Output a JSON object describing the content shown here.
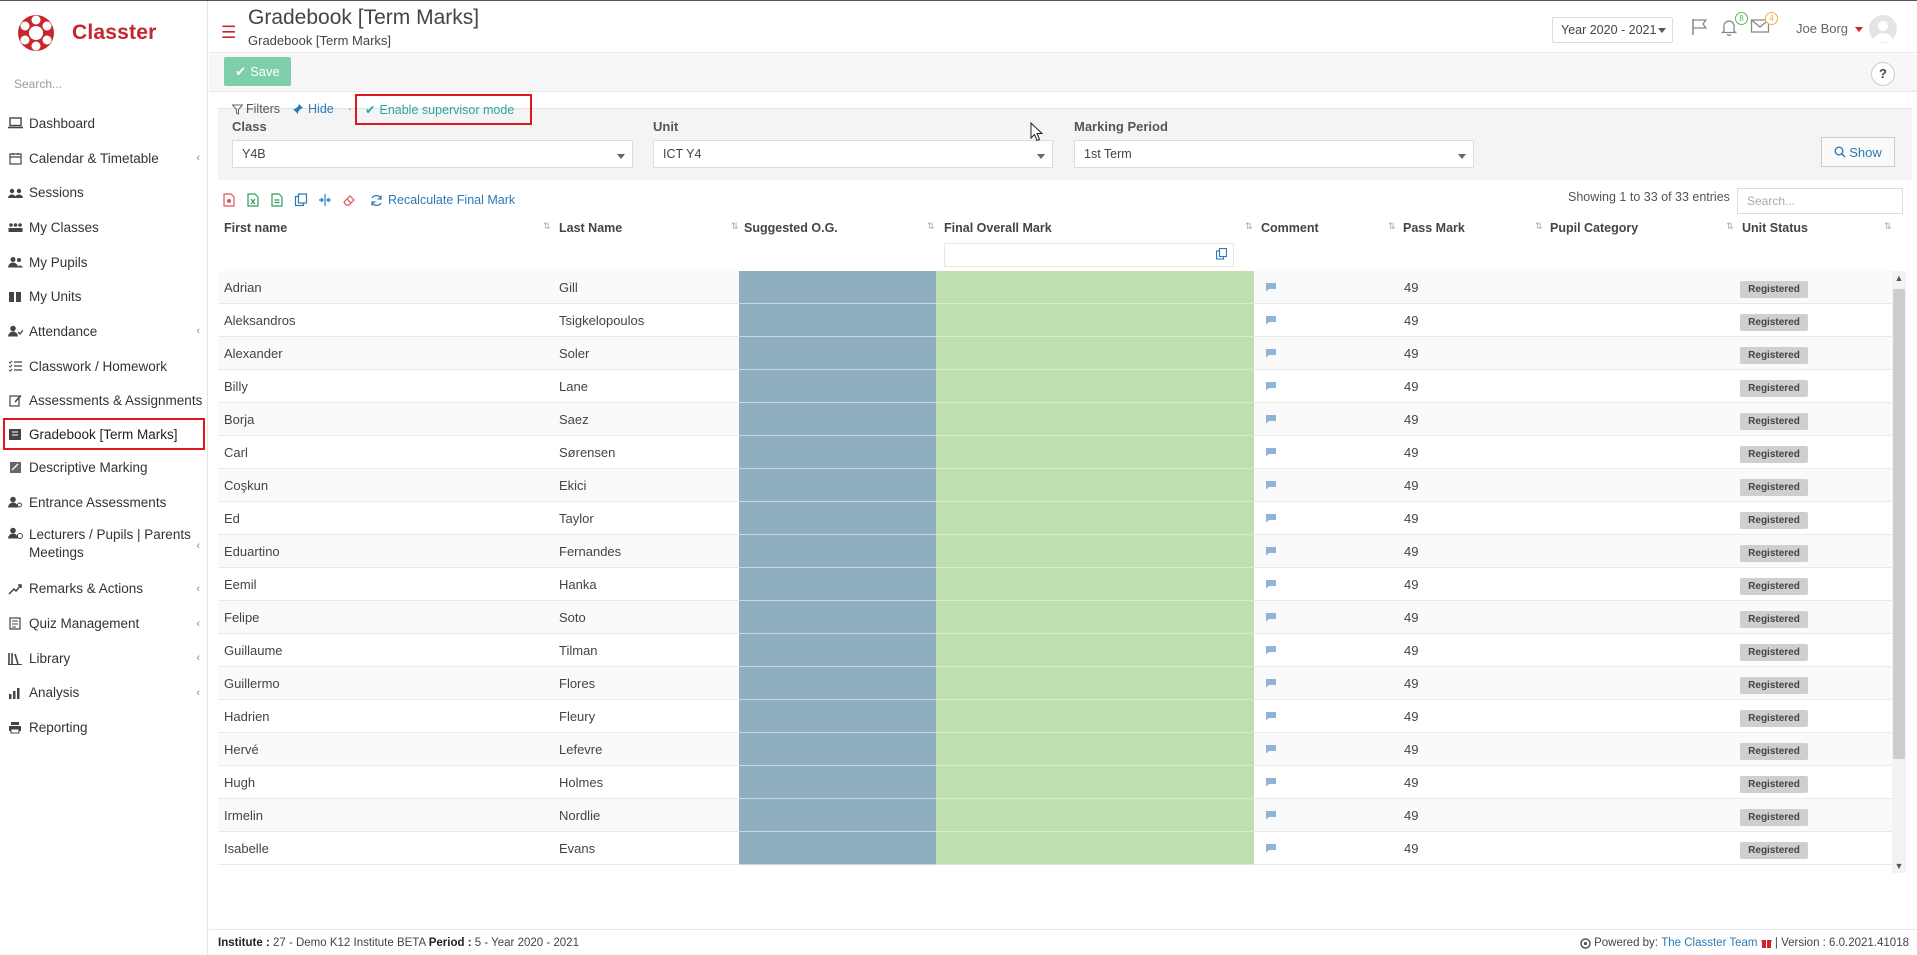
{
  "brand": {
    "name": "Classter"
  },
  "sidebar": {
    "search_placeholder": "Search...",
    "items": [
      {
        "label": "Dashboard",
        "icon": "laptop-icon",
        "chevron": false
      },
      {
        "label": "Calendar & Timetable",
        "icon": "calendar-icon",
        "chevron": true
      },
      {
        "label": "Sessions",
        "icon": "sessions-icon",
        "chevron": false
      },
      {
        "label": "My Classes",
        "icon": "classes-icon",
        "chevron": false
      },
      {
        "label": "My Pupils",
        "icon": "pupils-icon",
        "chevron": false
      },
      {
        "label": "My Units",
        "icon": "book-icon",
        "chevron": false
      },
      {
        "label": "Attendance",
        "icon": "attendance-icon",
        "chevron": true
      },
      {
        "label": "Classwork / Homework",
        "icon": "list-icon",
        "chevron": false
      },
      {
        "label": "Assessments & Assignments",
        "icon": "edit-icon",
        "chevron": false
      },
      {
        "label": "Gradebook [Term Marks]",
        "icon": "gradebook-icon",
        "chevron": false,
        "active": true
      },
      {
        "label": "Descriptive Marking",
        "icon": "descriptive-icon",
        "chevron": false
      },
      {
        "label": "Entrance Assessments",
        "icon": "user-icon",
        "chevron": false
      },
      {
        "label": "Lecturers / Pupils | Parents Meetings",
        "icon": "meetings-icon",
        "chevron": true
      },
      {
        "label": "Remarks & Actions",
        "icon": "remarks-icon",
        "chevron": true
      },
      {
        "label": "Quiz Management",
        "icon": "quiz-icon",
        "chevron": true
      },
      {
        "label": "Library",
        "icon": "library-icon",
        "chevron": true
      },
      {
        "label": "Analysis",
        "icon": "analysis-icon",
        "chevron": true
      },
      {
        "label": "Reporting",
        "icon": "printer-icon",
        "chevron": false
      }
    ]
  },
  "header": {
    "title": "Gradebook [Term Marks]",
    "subtitle": "Gradebook [Term Marks]",
    "year": "Year 2020 - 2021",
    "notifications_count": "8",
    "messages_count": "4",
    "user": "Joe Borg"
  },
  "toolbar": {
    "save_label": "Save",
    "help_label": "?"
  },
  "filters": {
    "filters_label": "Filters",
    "hide_label": "Hide",
    "supervisor_label": "Enable supervisor mode",
    "class_label": "Class",
    "class_value": "Y4B",
    "unit_label": "Unit",
    "unit_value": "ICT Y4",
    "period_label": "Marking Period",
    "period_value": "1st Term",
    "show_label": "Show"
  },
  "table": {
    "recalc_label": "Recalculate Final Mark",
    "showing": "Showing 1 to 33 of 33 entries",
    "search_placeholder": "Search...",
    "columns": [
      "First name",
      "Last Name",
      "Suggested O.G.",
      "Final Overall Mark",
      "Comment",
      "Pass Mark",
      "Pupil Category",
      "Unit Status"
    ],
    "rows": [
      {
        "first": "Adrian",
        "last": "Gill",
        "pass": "49",
        "status": "Registered"
      },
      {
        "first": "Aleksandros",
        "last": "Tsigkelopoulos",
        "pass": "49",
        "status": "Registered"
      },
      {
        "first": "Alexander",
        "last": "Soler",
        "pass": "49",
        "status": "Registered"
      },
      {
        "first": "Billy",
        "last": "Lane",
        "pass": "49",
        "status": "Registered"
      },
      {
        "first": "Borja",
        "last": "Saez",
        "pass": "49",
        "status": "Registered"
      },
      {
        "first": "Carl",
        "last": "Sørensen",
        "pass": "49",
        "status": "Registered"
      },
      {
        "first": "Coşkun",
        "last": "Ekici",
        "pass": "49",
        "status": "Registered"
      },
      {
        "first": "Ed",
        "last": "Taylor",
        "pass": "49",
        "status": "Registered"
      },
      {
        "first": "Eduartino",
        "last": "Fernandes",
        "pass": "49",
        "status": "Registered"
      },
      {
        "first": "Eemil",
        "last": "Hanka",
        "pass": "49",
        "status": "Registered"
      },
      {
        "first": "Felipe",
        "last": "Soto",
        "pass": "49",
        "status": "Registered"
      },
      {
        "first": "Guillaume",
        "last": "Tilman",
        "pass": "49",
        "status": "Registered"
      },
      {
        "first": "Guillermo",
        "last": "Flores",
        "pass": "49",
        "status": "Registered"
      },
      {
        "first": "Hadrien",
        "last": "Fleury",
        "pass": "49",
        "status": "Registered"
      },
      {
        "first": "Hervé",
        "last": "Lefevre",
        "pass": "49",
        "status": "Registered"
      },
      {
        "first": "Hugh",
        "last": "Holmes",
        "pass": "49",
        "status": "Registered"
      },
      {
        "first": "Irmelin",
        "last": "Nordlie",
        "pass": "49",
        "status": "Registered"
      },
      {
        "first": "Isabelle",
        "last": "Evans",
        "pass": "49",
        "status": "Registered"
      }
    ]
  },
  "footer": {
    "institute_label": "Institute :",
    "institute_value": "27 - Demo K12 Institute BETA",
    "period_label": "Period :",
    "period_value": "5 - Year 2020 - 2021",
    "powered_label": "Powered by:",
    "powered_link": "The Classter Team",
    "version": "| Version : 6.0.2021.41018"
  },
  "colors": {
    "brand": "#c9252c",
    "suggested_og": "#8fafbf",
    "final_mark": "#bee0ae",
    "highlight": "#e0161f"
  }
}
